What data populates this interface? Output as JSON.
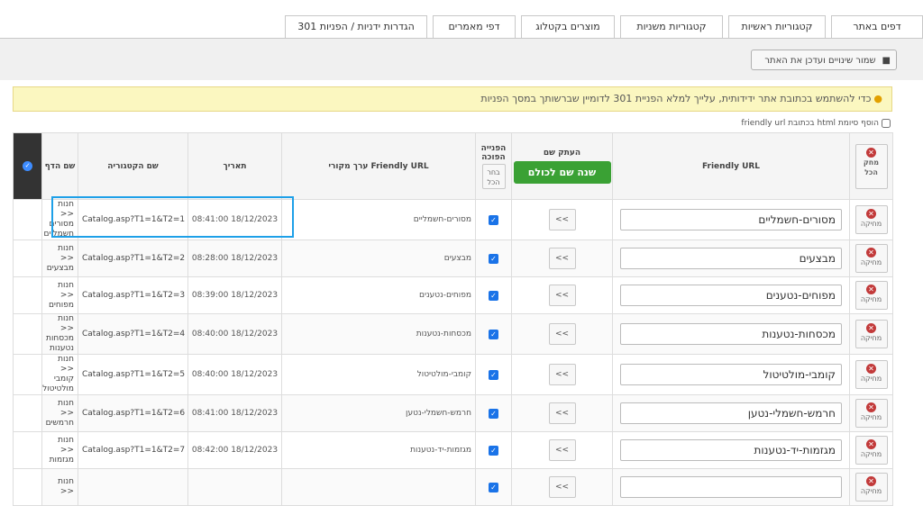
{
  "tabs": [
    {
      "label": "דפים באתר"
    },
    {
      "label": "קטגוריות ראשיות"
    },
    {
      "label": "קטגוריות משניות"
    },
    {
      "label": "מוצרים בקטלוג"
    },
    {
      "label": "דפי מאמרים"
    },
    {
      "label": "הגדרות ידניות / הפניות 301"
    }
  ],
  "toolbar": {
    "save_label": "שמור שינויים ועדכן את האתר"
  },
  "notice": "כדי להשתמש בכתובת אתר ידידותית, עלייך למלא הפניית 301 לדומיין שברשותך במסך הפניות",
  "friendly_checkbox_label": "הוסף סיומת html בכתובת friendly url",
  "table": {
    "headers": {
      "page_name": "שם הדף",
      "category_name": "שם הקטגוריה",
      "date": "תאריך",
      "orig_value": "Friendly URL ערך מקורי",
      "redirect": "הפנייה הפוכה",
      "pick_all": "בחר הכל",
      "copy_name": "העתק שם",
      "copy_all": "שנה שם לכולם",
      "friendly_url": "Friendly URL",
      "delete_all": "מחק הכל"
    },
    "delete_label": "מחיקה",
    "copy_arrow": "<<",
    "rows": [
      {
        "page": "חנות << מסורים חשמליים",
        "category": "Catalog.asp?T1=1&T2=1",
        "date": "18/12/2023 08:41:00",
        "orig": "מסורים-חשמליים",
        "url": "מסורים-חשמליים"
      },
      {
        "page": "חנות << מבצעים",
        "category": "Catalog.asp?T1=1&T2=2",
        "date": "18/12/2023 08:28:00",
        "orig": "מבצעים",
        "url": "מבצעים"
      },
      {
        "page": "חנות << מפוחים",
        "category": "Catalog.asp?T1=1&T2=3",
        "date": "18/12/2023 08:39:00",
        "orig": "מפוחים-נטענים",
        "url": "מפוחים-נטענים"
      },
      {
        "page": "חנות << מכסחות נטענות",
        "category": "Catalog.asp?T1=1&T2=4",
        "date": "18/12/2023 08:40:00",
        "orig": "מכסחות-נטענות",
        "url": "מכסחות-נטענות"
      },
      {
        "page": "חנות << קומבי מולטיטול",
        "category": "Catalog.asp?T1=1&T2=5",
        "date": "18/12/2023 08:40:00",
        "orig": "קומבי-מולטיטול",
        "url": "קומבי-מולטיטול"
      },
      {
        "page": "חנות << חרמשים",
        "category": "Catalog.asp?T1=1&T2=6",
        "date": "18/12/2023 08:41:00",
        "orig": "חרמש-חשמלי-נטען",
        "url": "חרמש-חשמלי-נטען"
      },
      {
        "page": "חנות << מגזמות",
        "category": "Catalog.asp?T1=1&T2=7",
        "date": "18/12/2023 08:42:00",
        "orig": "מגזמות-יד-נטענות",
        "url": "מגזמות-יד-נטענות"
      },
      {
        "page": "חנות <<",
        "category": "",
        "date": "",
        "orig": "",
        "url": ""
      }
    ]
  }
}
